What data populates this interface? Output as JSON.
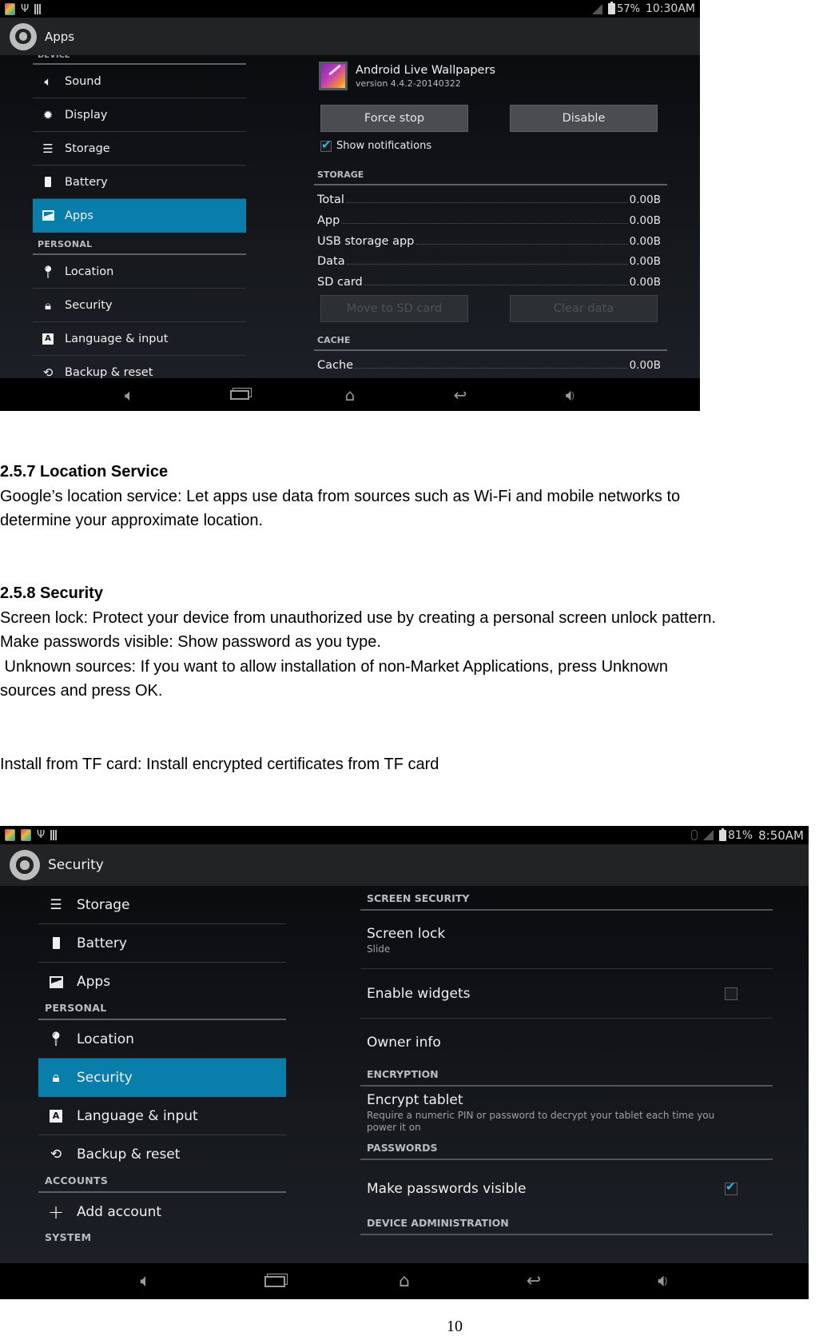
{
  "apps_screenshot": {
    "statusbar": {
      "battery": "57%",
      "time": "10:30AM"
    },
    "actionbar": {
      "title": "Apps",
      "icon": "settings-gear-icon"
    },
    "sidebar": {
      "cut_header": "DEVICE",
      "items": [
        {
          "label": "Sound",
          "icon": "volume-icon"
        },
        {
          "label": "Display",
          "icon": "brightness-icon"
        },
        {
          "label": "Storage",
          "icon": "storage-icon"
        },
        {
          "label": "Battery",
          "icon": "battery-icon"
        },
        {
          "label": "Apps",
          "icon": "apps-icon",
          "active": true
        }
      ],
      "personal_header": "PERSONAL",
      "personal_items": [
        {
          "label": "Location",
          "icon": "location-pin-icon"
        },
        {
          "label": "Security",
          "icon": "lock-icon"
        },
        {
          "label": "Language & input",
          "icon": "keyboard-a-icon"
        },
        {
          "label": "Backup & reset",
          "icon": "restore-icon"
        }
      ]
    },
    "detail": {
      "app_name": "Android Live Wallpapers",
      "app_version": "version 4.4.2-20140322",
      "force_stop": "Force stop",
      "disable": "Disable",
      "show_notifications": "Show notifications",
      "show_notifications_checked": true,
      "storage_header": "STORAGE",
      "storage_rows": [
        {
          "label": "Total",
          "value": "0.00B"
        },
        {
          "label": "App",
          "value": "0.00B"
        },
        {
          "label": "USB storage app",
          "value": "0.00B"
        },
        {
          "label": "Data",
          "value": "0.00B"
        },
        {
          "label": "SD card",
          "value": "0.00B"
        }
      ],
      "move_to_sd": "Move to SD card",
      "clear_data": "Clear data",
      "cache_header": "CACHE",
      "cache_rows": [
        {
          "label": "Cache",
          "value": "0.00B"
        }
      ]
    },
    "navbar": [
      "volume-down-icon",
      "recent-apps-icon",
      "home-icon",
      "back-icon",
      "volume-up-icon"
    ]
  },
  "document": {
    "location": {
      "heading": "2.5.7  Location Service",
      "lines": [
        "Google’s location service: Let apps use data from sources such as Wi-Fi and mobile networks to",
        "determine your approximate location."
      ]
    },
    "security": {
      "heading": "2.5.8 Security",
      "lines": [
        "Screen lock: Protect your device from unauthorized use by creating a personal screen unlock pattern.",
        "Make passwords visible: Show password as you type.",
        " Unknown sources: If you want to allow installation of non-Market Applications, press Unknown",
        "sources and press OK."
      ],
      "install_line": "Install from TF card: Install encrypted certificates from TF card"
    },
    "page_number": "10"
  },
  "security_screenshot": {
    "statusbar": {
      "battery": "81%",
      "time": "8:50AM"
    },
    "actionbar": {
      "title": "Security",
      "icon": "settings-gear-icon"
    },
    "sidebar": {
      "items": [
        {
          "label": "Storage",
          "icon": "storage-icon"
        },
        {
          "label": "Battery",
          "icon": "battery-icon"
        },
        {
          "label": "Apps",
          "icon": "apps-icon"
        }
      ],
      "personal_header": "PERSONAL",
      "personal_items": [
        {
          "label": "Location",
          "icon": "location-pin-icon"
        },
        {
          "label": "Security",
          "icon": "lock-icon",
          "active": true
        },
        {
          "label": "Language & input",
          "icon": "keyboard-a-icon"
        },
        {
          "label": "Backup & reset",
          "icon": "restore-icon"
        }
      ],
      "accounts_header": "ACCOUNTS",
      "accounts_items": [
        {
          "label": "Add account",
          "icon": "plus-icon"
        }
      ],
      "system_header": "SYSTEM"
    },
    "pane": {
      "screen_security_header": "SCREEN SECURITY",
      "screen_lock_title": "Screen lock",
      "screen_lock_summary": "Slide",
      "enable_widgets": "Enable widgets",
      "enable_widgets_checked": false,
      "owner_info": "Owner info",
      "encryption_header": "ENCRYPTION",
      "encrypt_title": "Encrypt tablet",
      "encrypt_summary": "Require a numeric PIN or password to decrypt your tablet each time you power it on",
      "passwords_header": "PASSWORDS",
      "make_visible": "Make passwords visible",
      "make_visible_checked": true,
      "device_admin_header": "DEVICE ADMINISTRATION"
    },
    "navbar": [
      "volume-down-icon",
      "recent-apps-icon",
      "home-icon",
      "back-icon",
      "volume-up-icon"
    ]
  }
}
